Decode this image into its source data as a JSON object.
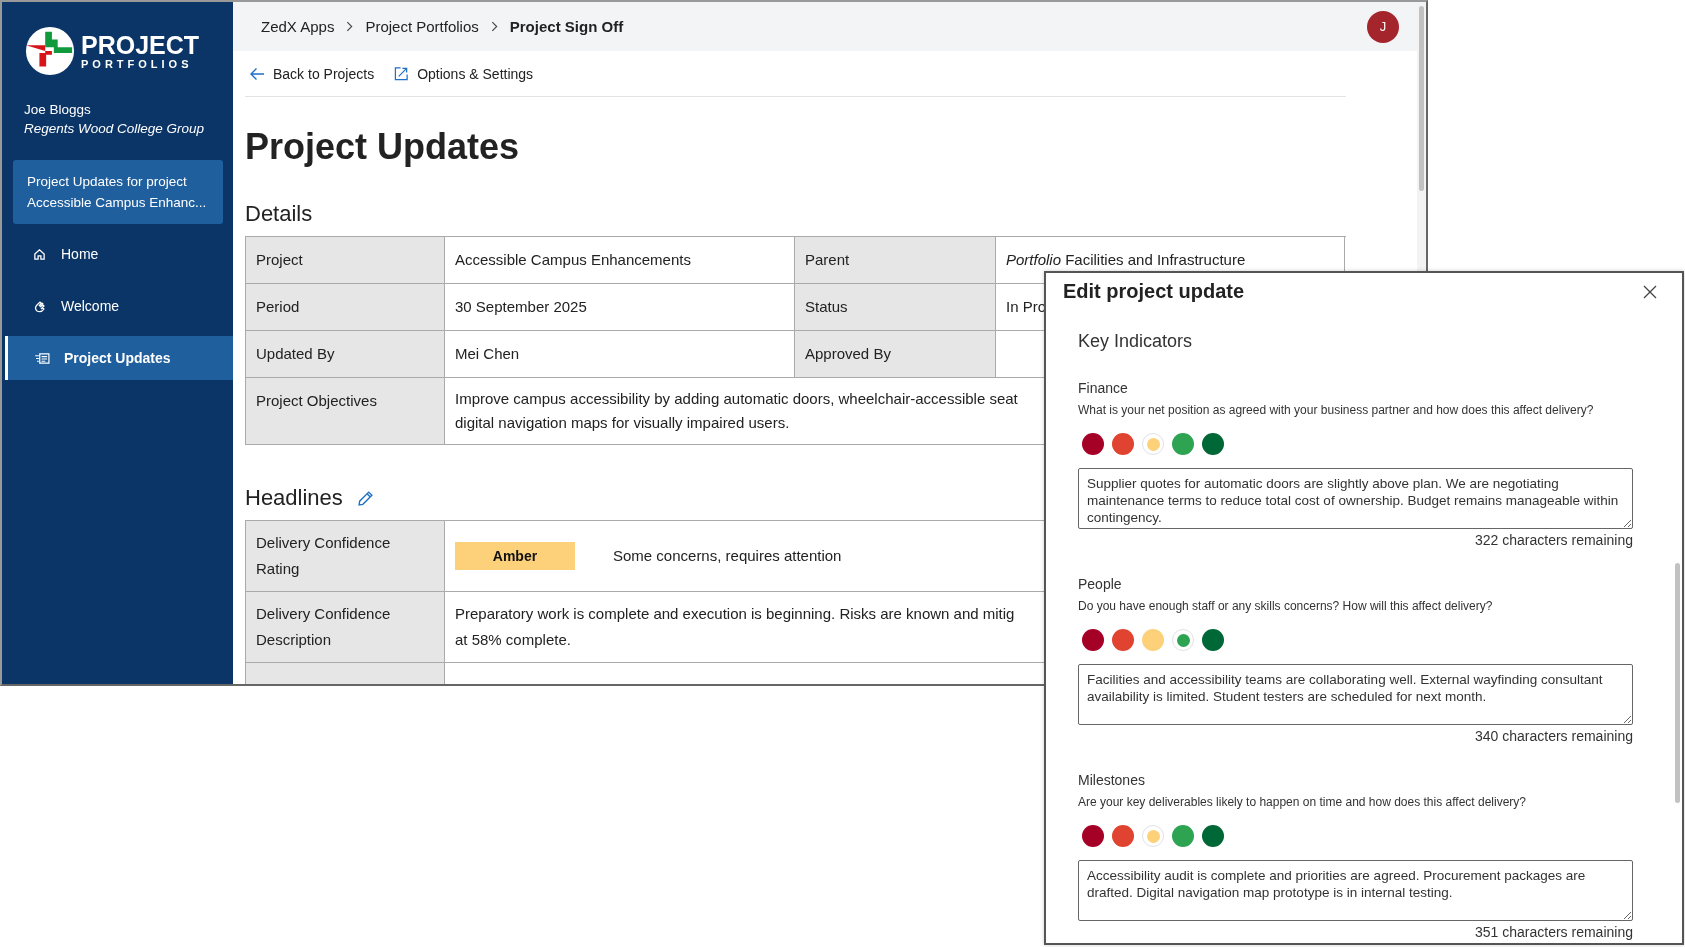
{
  "app": {
    "logo_title": "PROJECT",
    "logo_subtitle": "PORTFOLIOS",
    "user_name": "Joe Bloggs",
    "organisation": "Regents Wood College Group",
    "context_card": "Project Updates for project Accessible Campus Enhanc...",
    "avatar_initial": "J"
  },
  "sidebar": {
    "items": [
      {
        "label": "Home",
        "selected": false
      },
      {
        "label": "Welcome",
        "selected": false
      },
      {
        "label": "Project Updates",
        "selected": true
      }
    ]
  },
  "breadcrumbs": [
    {
      "label": "ZedX Apps",
      "current": false
    },
    {
      "label": "Project Portfolios",
      "current": false
    },
    {
      "label": "Project Sign Off",
      "current": true
    }
  ],
  "toolbar": [
    {
      "label": "Back to Projects"
    },
    {
      "label": "Options & Settings"
    }
  ],
  "page_title": "Project Updates",
  "details": {
    "heading": "Details",
    "rows": [
      {
        "cells": [
          {
            "kind": "header",
            "text": "Project"
          },
          {
            "kind": "value",
            "text": "Accessible Campus Enhancements"
          },
          {
            "kind": "header",
            "text": "Parent"
          },
          {
            "kind": "value",
            "text": "*Portfolio* Facilities and Infrastructure"
          }
        ]
      },
      {
        "cells": [
          {
            "kind": "header",
            "text": "Period"
          },
          {
            "kind": "value",
            "text": "30 September 2025"
          },
          {
            "kind": "header",
            "text": "Status"
          },
          {
            "kind": "value",
            "text": "In Pro"
          }
        ]
      },
      {
        "cells": [
          {
            "kind": "header",
            "text": "Updated By"
          },
          {
            "kind": "value",
            "text": "Mei Chen"
          },
          {
            "kind": "header",
            "text": "Approved By"
          },
          {
            "kind": "value"
          }
        ]
      },
      {
        "cells": [
          {
            "kind": "header",
            "text": "Project Objectives"
          },
          {
            "kind": "wide",
            "text": "Improve campus accessibility by adding automatic doors, wheelchair-accessible seat\ndigital navigation maps for visually impaired users."
          }
        ]
      }
    ]
  },
  "headlines": {
    "heading": "Headlines",
    "rows": [
      {
        "kind": "rating",
        "label": "Delivery Confidence\nRating",
        "rating": {
          "label": "Amber",
          "color": "#fdd17a"
        },
        "text": "Some concerns, requires attention"
      },
      {
        "kind": "text",
        "label": "Delivery Confidence\nDescription",
        "text": "Preparatory work is complete and execution is beginning. Risks are known and mitig\nat 58% complete."
      },
      {
        "kind": "blank"
      }
    ]
  },
  "dialog": {
    "title": "Edit project update",
    "section": "Key Indicators",
    "indicators": [
      {
        "name": "Finance",
        "question": "What is your net position as agreed with your business partner and how does this affect delivery?",
        "ratings": [
          {
            "color": "#a50026",
            "selected": false
          },
          {
            "color": "#e0432f",
            "selected": false
          },
          {
            "color": "#fdd17a",
            "selected": true
          },
          {
            "color": "#2ea453",
            "selected": false
          },
          {
            "color": "#006837",
            "selected": false
          }
        ],
        "value": "Supplier quotes for automatic doors are slightly above plan. We are negotiating maintenance terms to reduce total cost of ownership. Budget remains manageable within contingency.",
        "counter": "322 characters remaining"
      },
      {
        "name": "People",
        "question": "Do you have enough staff or any skills concerns? How will this affect delivery?",
        "ratings": [
          {
            "color": "#a50026",
            "selected": false
          },
          {
            "color": "#e0432f",
            "selected": false
          },
          {
            "color": "#fdd17a",
            "selected": false
          },
          {
            "color": "#2ea453",
            "selected": true
          },
          {
            "color": "#006837",
            "selected": false
          }
        ],
        "value": "Facilities and accessibility teams are collaborating well. External wayfinding consultant availability is limited. Student testers are scheduled for next month.",
        "counter": "340 characters remaining"
      },
      {
        "name": "Milestones",
        "question": "Are your key deliverables likely to happen on time and how does this affect delivery?",
        "ratings": [
          {
            "color": "#a50026",
            "selected": false
          },
          {
            "color": "#e0432f",
            "selected": false
          },
          {
            "color": "#fdd17a",
            "selected": true
          },
          {
            "color": "#2ea453",
            "selected": false
          },
          {
            "color": "#006837",
            "selected": false
          }
        ],
        "value": "Accessibility audit is complete and priorities are agreed. Procurement packages are drafted. Digital navigation map prototype is in internal testing.",
        "counter": "351 characters remaining"
      }
    ]
  }
}
